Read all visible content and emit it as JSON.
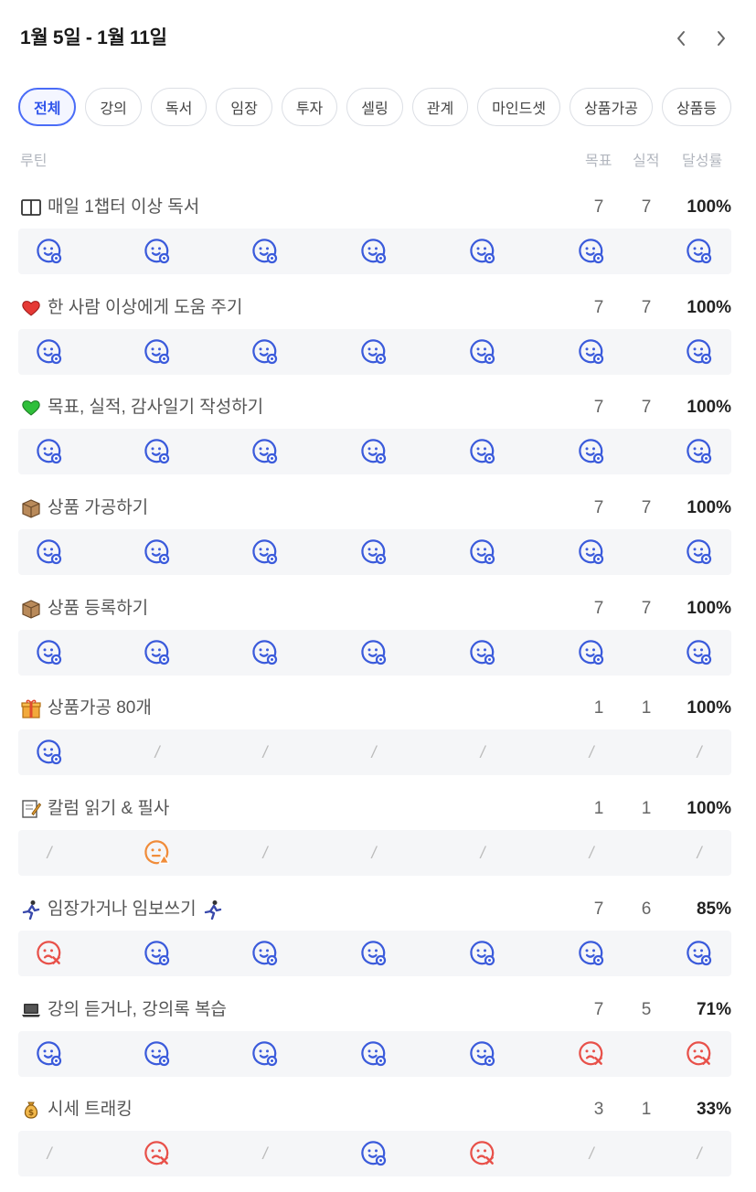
{
  "header": {
    "title": "1월 5일 - 1월 11일"
  },
  "chips": [
    {
      "label": "전체",
      "active": true
    },
    {
      "label": "강의",
      "active": false
    },
    {
      "label": "독서",
      "active": false
    },
    {
      "label": "임장",
      "active": false
    },
    {
      "label": "투자",
      "active": false
    },
    {
      "label": "셀링",
      "active": false
    },
    {
      "label": "관계",
      "active": false
    },
    {
      "label": "마인드셋",
      "active": false
    },
    {
      "label": "상품가공",
      "active": false
    },
    {
      "label": "상품등",
      "active": false
    }
  ],
  "columns": {
    "routine": "루틴",
    "goal": "목표",
    "actual": "실적",
    "rate": "달성률"
  },
  "colors": {
    "done": "#3b5bdb",
    "partial": "#f08c3a",
    "fail": "#e8514a",
    "accent": "#4a6cf7"
  },
  "routines": [
    {
      "icon": "book-icon",
      "name": "매일 1챕터 이상 독서",
      "goal": "7",
      "actual": "7",
      "rate": "100%",
      "days": [
        "done",
        "done",
        "done",
        "done",
        "done",
        "done",
        "done"
      ]
    },
    {
      "icon": "red-heart-icon",
      "name": "한 사람 이상에게 도움 주기",
      "goal": "7",
      "actual": "7",
      "rate": "100%",
      "days": [
        "done",
        "done",
        "done",
        "done",
        "done",
        "done",
        "done"
      ]
    },
    {
      "icon": "green-heart-icon",
      "name": "목표, 실적, 감사일기 작성하기",
      "goal": "7",
      "actual": "7",
      "rate": "100%",
      "days": [
        "done",
        "done",
        "done",
        "done",
        "done",
        "done",
        "done"
      ]
    },
    {
      "icon": "package-icon",
      "name": "상품 가공하기",
      "goal": "7",
      "actual": "7",
      "rate": "100%",
      "days": [
        "done",
        "done",
        "done",
        "done",
        "done",
        "done",
        "done"
      ]
    },
    {
      "icon": "package-icon",
      "name": "상품 등록하기",
      "goal": "7",
      "actual": "7",
      "rate": "100%",
      "days": [
        "done",
        "done",
        "done",
        "done",
        "done",
        "done",
        "done"
      ]
    },
    {
      "icon": "gift-icon",
      "name": "상품가공 80개",
      "goal": "1",
      "actual": "1",
      "rate": "100%",
      "days": [
        "done",
        "none",
        "none",
        "none",
        "none",
        "none",
        "none"
      ]
    },
    {
      "icon": "memo-icon",
      "name": "칼럼 읽기 & 필사",
      "goal": "1",
      "actual": "1",
      "rate": "100%",
      "days": [
        "none",
        "partial",
        "none",
        "none",
        "none",
        "none",
        "none"
      ]
    },
    {
      "icon": "runner-icon",
      "name": "임장가거나 임보쓰기",
      "goal": "7",
      "actual": "6",
      "rate": "85%",
      "suffix_icon": "runner-icon",
      "days": [
        "fail",
        "done",
        "done",
        "done",
        "done",
        "done",
        "done"
      ]
    },
    {
      "icon": "laptop-icon",
      "name": "강의 듣거나, 강의록 복습",
      "goal": "7",
      "actual": "5",
      "rate": "71%",
      "days": [
        "done",
        "done",
        "done",
        "done",
        "done",
        "fail",
        "fail"
      ]
    },
    {
      "icon": "money-bag-icon",
      "name": "시세 트래킹",
      "goal": "3",
      "actual": "1",
      "rate": "33%",
      "days": [
        "none",
        "fail",
        "none",
        "done",
        "fail",
        "none",
        "none"
      ]
    }
  ]
}
